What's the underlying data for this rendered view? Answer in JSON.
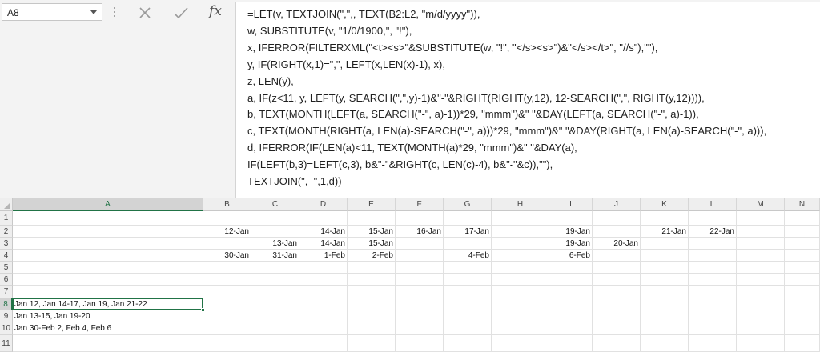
{
  "name_box": {
    "value": "A8"
  },
  "formula_bar": {
    "fx_label": "fx",
    "lines": [
      "=LET(v, TEXTJOIN(\",\",, TEXT(B2:L2, \"m/d/yyyy\")),",
      "w, SUBSTITUTE(v, \"1/0/1900,\", \"!\"),",
      "x, IFERROR(FILTERXML(\"<t><s>\"&SUBSTITUTE(w, \"!\", \"</s><s>\")&\"</s></t>\", \"//s\"),\"\"),",
      "y, IF(RIGHT(x,1)=\",\", LEFT(x,LEN(x)-1), x),",
      "z, LEN(y),",
      "a, IF(z<11, y, LEFT(y, SEARCH(\",\",y)-1)&\"-\"&RIGHT(RIGHT(y,12), 12-SEARCH(\",\", RIGHT(y,12)))),",
      "b, TEXT(MONTH(LEFT(a, SEARCH(\"-\", a)-1))*29, \"mmm\")&\" \"&DAY(LEFT(a, SEARCH(\"-\", a)-1)),",
      "c, TEXT(MONTH(RIGHT(a, LEN(a)-SEARCH(\"-\", a)))*29, \"mmm\")&\" \"&DAY(RIGHT(a, LEN(a)-SEARCH(\"-\", a))),",
      "d, IFERROR(IF(LEN(a)<11, TEXT(MONTH(a)*29, \"mmm\")&\" \"&DAY(a),",
      "IF(LEFT(b,3)=LEFT(c,3), b&\"-\"&RIGHT(c, LEN(c)-4), b&\"-\"&c)),\"\"),",
      "TEXTJOIN(\",  \",1,d))"
    ]
  },
  "columns": [
    "A",
    "B",
    "C",
    "D",
    "E",
    "F",
    "G",
    "H",
    "I",
    "J",
    "K",
    "L",
    "M",
    "N"
  ],
  "rows": [
    "1",
    "2",
    "3",
    "4",
    "5",
    "6",
    "7",
    "8",
    "9",
    "10",
    "11"
  ],
  "selected_cell": {
    "column": "A",
    "row": "8"
  },
  "cells": {
    "B2": "12-Jan",
    "D2": "14-Jan",
    "E2": "15-Jan",
    "F2": "16-Jan",
    "G2": "17-Jan",
    "I2": "19-Jan",
    "K2": "21-Jan",
    "L2": "22-Jan",
    "C3": "13-Jan",
    "D3": "14-Jan",
    "E3": "15-Jan",
    "I3": "19-Jan",
    "J3": "20-Jan",
    "B4": "30-Jan",
    "C4": "31-Jan",
    "D4": "1-Feb",
    "E4": "2-Feb",
    "G4": "4-Feb",
    "I4": "6-Feb",
    "A8": "Jan 12,  Jan 14-17,  Jan 19,  Jan 21-22",
    "A9": "Jan 13-15,  Jan 19-20",
    "A10": "Jan 30-Feb 2,  Feb 4,  Feb 6"
  },
  "icons": {
    "cancel": "close-x-icon",
    "enter": "checkmark-icon",
    "insert_function": "fx-icon",
    "name_box_dropdown": "chevron-down-icon"
  },
  "colors": {
    "selection_accent": "#217346"
  }
}
